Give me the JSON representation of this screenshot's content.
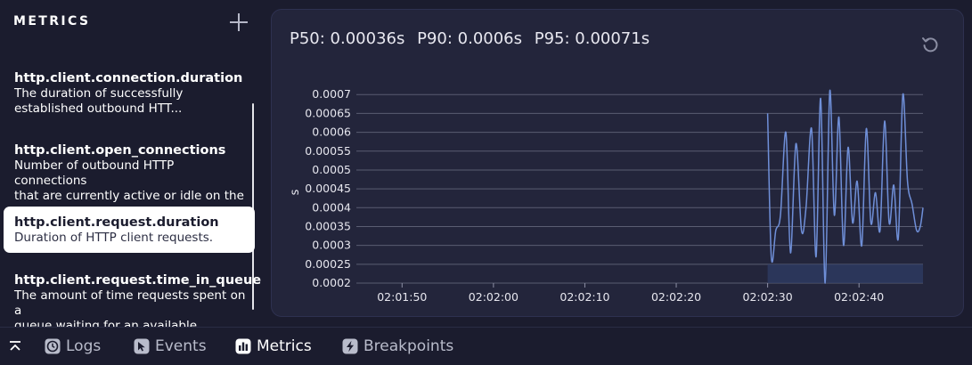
{
  "sidebar": {
    "title": "METRICS",
    "items": [
      {
        "name": "http.client.connection.duration",
        "desc_lines": [
          "The duration of successfully",
          "established outbound HTT..."
        ]
      },
      {
        "name": "http.client.open_connections",
        "desc_lines": [
          "Number of outbound HTTP connections",
          "that are currently active or idle on the"
        ]
      },
      {
        "name": "http.client.request.duration",
        "desc_lines": [
          "Duration of HTTP client requests."
        ]
      },
      {
        "name": "http.client.request.time_in_queue",
        "desc_lines": [
          "The amount of time requests spent on a",
          "queue waiting for an available"
        ]
      }
    ]
  },
  "stats": {
    "p50": "P50: 0.00036s",
    "p90": "P90: 0.0006s",
    "p95": "P95: 0.00071s"
  },
  "chart_data": {
    "type": "line",
    "ylabel": "s",
    "xlabel": "",
    "yticks": [
      "0.0002",
      "0.00025",
      "0.0003",
      "0.00035",
      "0.0004",
      "0.00045",
      "0.0005",
      "0.00055",
      "0.0006",
      "0.00065",
      "0.0007"
    ],
    "xticks": [
      "02:01:50",
      "02:02:00",
      "02:02:10",
      "02:02:20",
      "02:02:30",
      "02:02:40"
    ],
    "ylim": [
      0.0002,
      0.00071
    ],
    "xlim_seconds_after_02_01_45": [
      0,
      62
    ],
    "grid": true,
    "series": [
      {
        "color": "#6f8fd8",
        "x": [
          45.0,
          45.4,
          45.9,
          46.4,
          47.0,
          47.5,
          48.1,
          48.7,
          49.2,
          49.8,
          50.3,
          50.8,
          51.3,
          51.8,
          52.3,
          52.8,
          53.3,
          53.8,
          54.3,
          54.8,
          55.3,
          55.8,
          56.3,
          56.8,
          57.3,
          57.8,
          58.3,
          58.8,
          59.3,
          59.8,
          60.3,
          60.8,
          61.3,
          61.7,
          62.0
        ],
        "y": [
          0.00065,
          0.00027,
          0.00034,
          0.00038,
          0.0006,
          0.00028,
          0.00057,
          0.00034,
          0.0004,
          0.00061,
          0.00027,
          0.00069,
          0.0002,
          0.00071,
          0.00038,
          0.00064,
          0.0003,
          0.00056,
          0.00036,
          0.00047,
          0.0003,
          0.00061,
          0.00036,
          0.00044,
          0.00034,
          0.00063,
          0.00036,
          0.00046,
          0.00032,
          0.0007,
          0.00047,
          0.00041,
          0.00034,
          0.00035,
          0.0004
        ]
      }
    ]
  },
  "tabs": [
    {
      "label": "Logs",
      "icon": "clock-icon"
    },
    {
      "label": "Events",
      "icon": "cursor-icon"
    },
    {
      "label": "Metrics",
      "icon": "bar-chart-icon"
    },
    {
      "label": "Breakpoints",
      "icon": "lightning-icon"
    }
  ]
}
